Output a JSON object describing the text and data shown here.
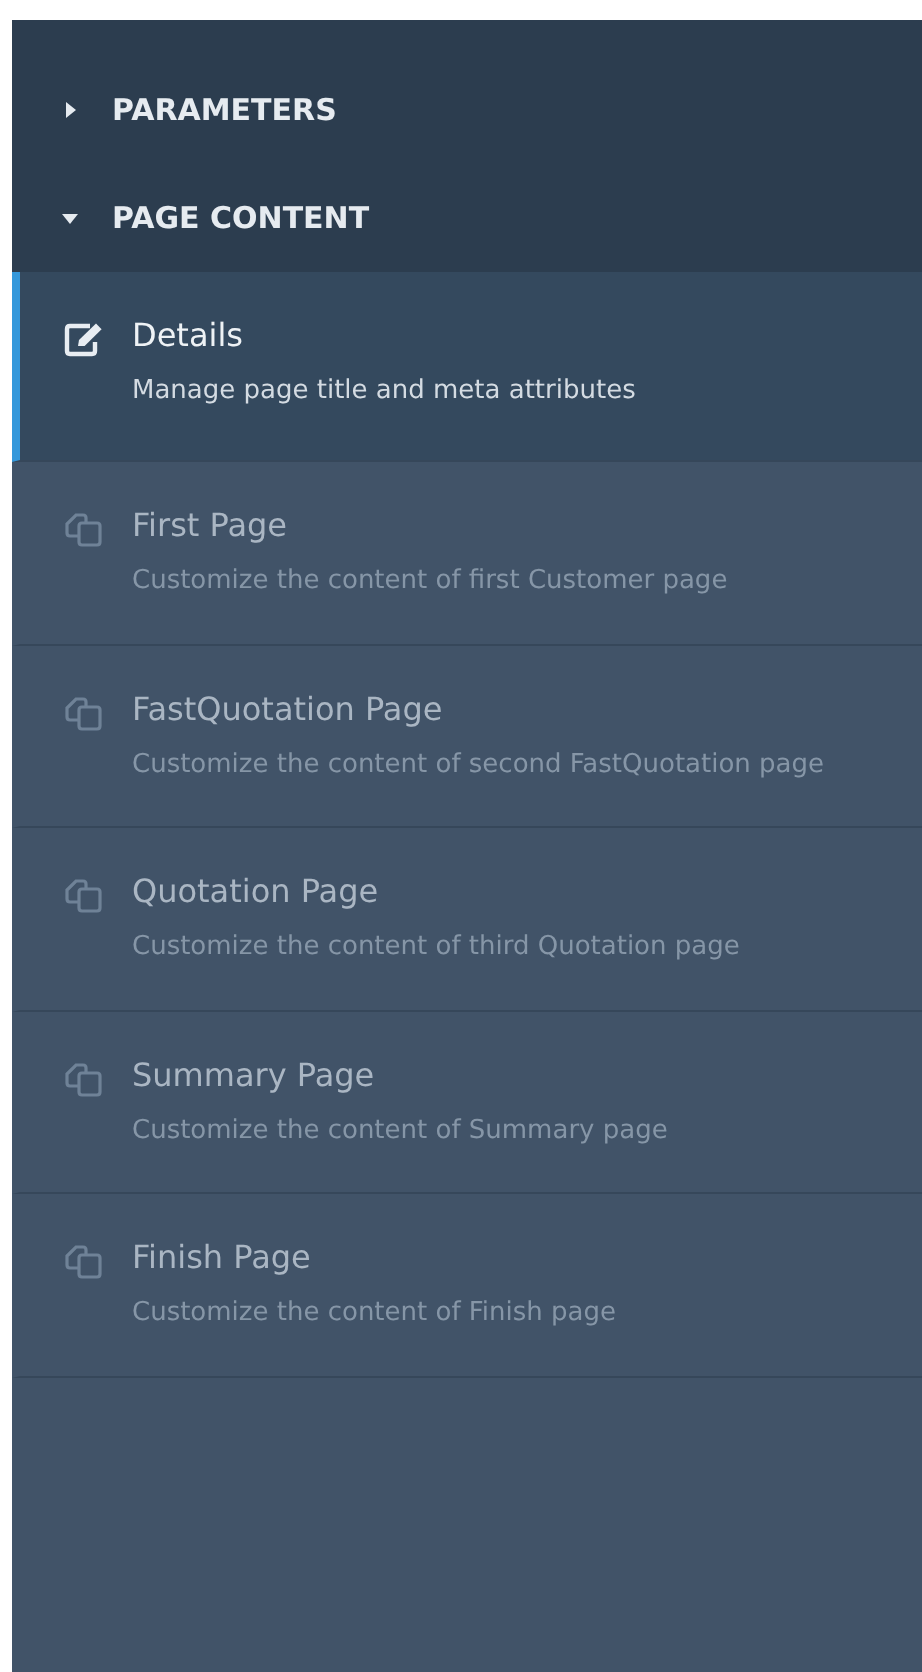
{
  "sections": [
    {
      "label": "PARAMETERS",
      "expanded": false
    },
    {
      "label": "PAGE CONTENT",
      "expanded": true
    }
  ],
  "items": [
    {
      "kind": "edit",
      "title": "Details",
      "description": "Manage page title and meta attributes",
      "selected": true
    },
    {
      "kind": "copy",
      "title": "First Page",
      "description": "Customize the content of first Customer page",
      "selected": false
    },
    {
      "kind": "copy",
      "title": "FastQuotation Page",
      "description": "Customize the content of second FastQuotation page",
      "selected": false
    },
    {
      "kind": "copy",
      "title": "Quotation Page",
      "description": "Customize the content of third Quotation page",
      "selected": false
    },
    {
      "kind": "copy",
      "title": "Summary Page",
      "description": "Customize the content of Summary page",
      "selected": false
    },
    {
      "kind": "copy",
      "title": "Finish Page",
      "description": "Customize the content of Finish page",
      "selected": false
    }
  ]
}
